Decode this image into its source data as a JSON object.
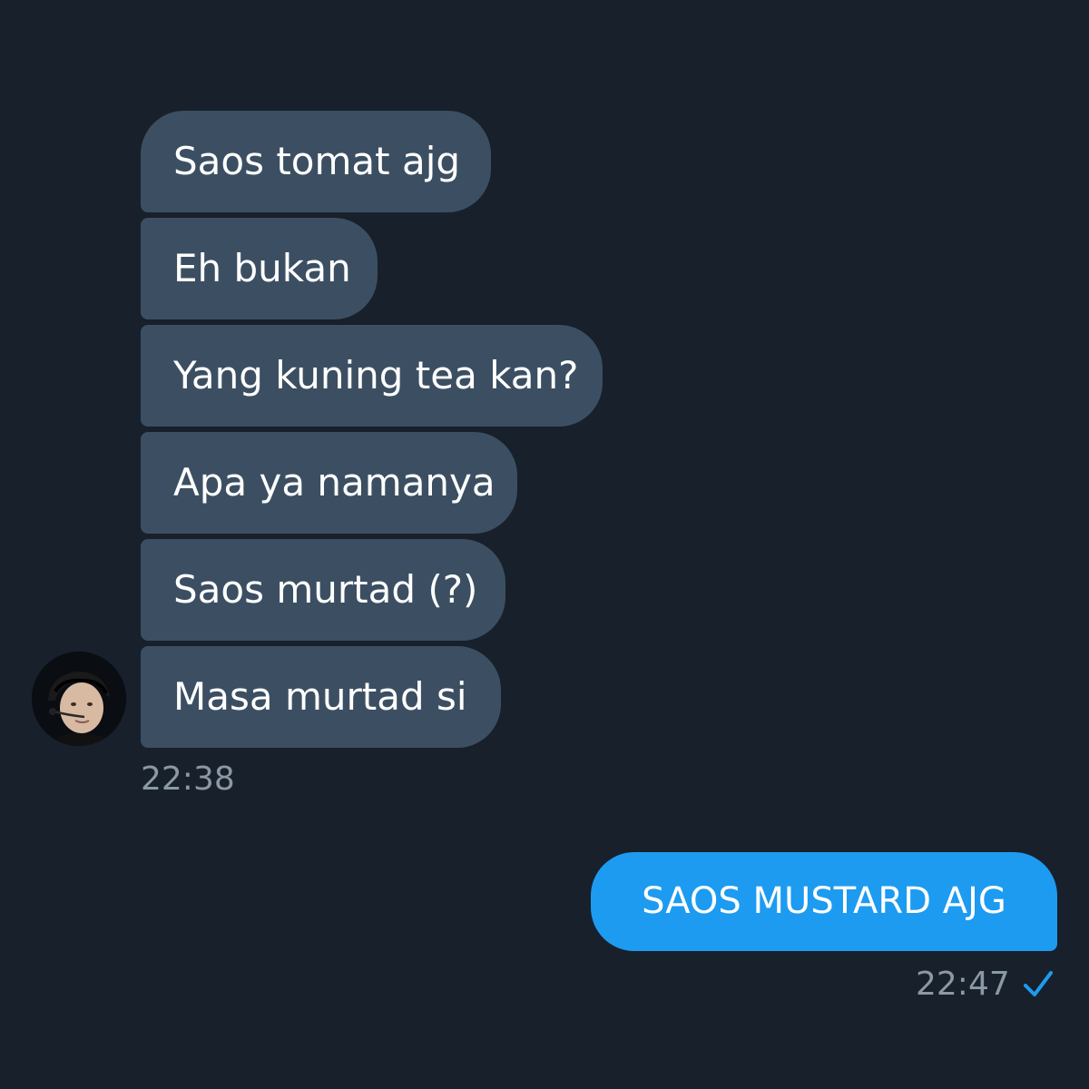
{
  "conversation": {
    "incoming_messages": [
      {
        "text": "Saos tomat ajg"
      },
      {
        "text": "Eh bukan"
      },
      {
        "text": "Yang kuning tea kan?"
      },
      {
        "text": "Apa ya namanya"
      },
      {
        "text": "Saos murtad (?)"
      },
      {
        "text": "Masa murtad si"
      }
    ],
    "incoming_time": "22:38",
    "outgoing_messages": [
      {
        "text": "SAOS MUSTARD AJG"
      }
    ],
    "outgoing_time": "22:47",
    "outgoing_status_icon": "checkmark-icon"
  },
  "colors": {
    "background": "#17202b",
    "incoming_bubble": "#3c4f62",
    "outgoing_bubble": "#1d9bf0",
    "timestamp": "#8b98a5",
    "read_check": "#1d9bf0"
  }
}
